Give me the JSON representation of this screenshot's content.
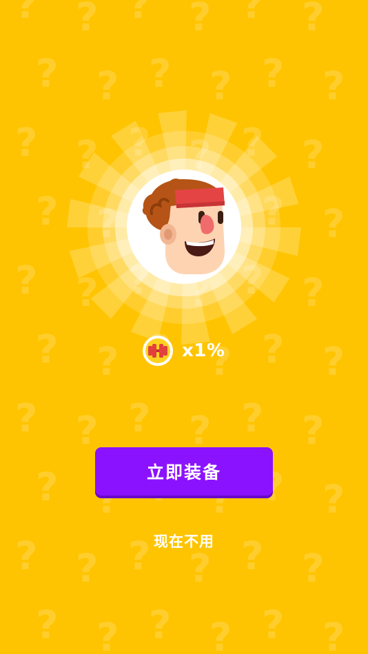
{
  "colors": {
    "background": "#FFC401",
    "button": "#8B12FF",
    "button_shadow": "#6A07C9",
    "text": "#FFFFFF"
  },
  "background_pattern": {
    "glyph": "?"
  },
  "reward": {
    "avatar_icon": "cartoon-boy-headband-avatar",
    "bonus_icon": "dumbbell-coin-icon",
    "bonus_text": "x1%"
  },
  "actions": {
    "equip_label": "立即装备",
    "skip_label": "现在不用"
  }
}
